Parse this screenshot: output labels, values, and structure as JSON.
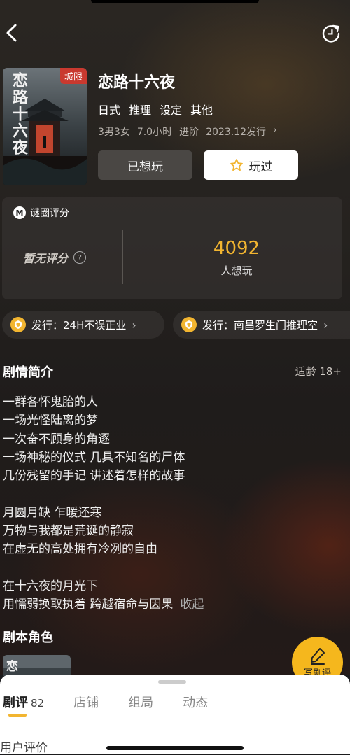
{
  "header": {
    "back_icon": "chevron-left-icon",
    "refresh_icon": "refresh-icon"
  },
  "game": {
    "cover_title_chars": "恋路十六夜",
    "cover_tag": "城限",
    "title": "恋路十六夜",
    "tags": [
      "日式",
      "推理",
      "设定",
      "其他"
    ],
    "meta": [
      "3男3女",
      "7.0小时",
      "进阶",
      "2023.12发行"
    ]
  },
  "actions": {
    "wanted_label": "已想玩",
    "played_label": "玩过"
  },
  "rating": {
    "logo_text": "M",
    "header_label": "谜圈评分",
    "no_rating_label": "暂无评分",
    "help_glyph": "?",
    "want_count": "4092",
    "want_label": "人想玩"
  },
  "publishers": [
    {
      "label": "发行：24H不误正业"
    },
    {
      "label": "发行：南昌罗生门推理室"
    }
  ],
  "synopsis": {
    "title": "剧情简介",
    "age_label": "适龄 18+",
    "lines": [
      "一群各怀鬼胎的人",
      "一场光怪陆离的梦",
      "一次奋不顾身的角逐",
      "一场神秘的仪式  几具不知名的尸体",
      "几份残留的手记  讲述着怎样的故事",
      "",
      "月圆月缺 乍暖还寒",
      "万物与我都是荒诞的静寂",
      "在虚无的高处拥有冷冽的自由",
      "",
      "在十六夜的月光下",
      "用懦弱换取执着  跨越宿命与因果"
    ],
    "collapse_label": "收起"
  },
  "roles": {
    "title": "剧本角色"
  },
  "fab": {
    "label": "写剧评",
    "icon": "pen-icon"
  },
  "tabs": [
    {
      "label": "剧评",
      "count": "82"
    },
    {
      "label": "店铺"
    },
    {
      "label": "组局"
    },
    {
      "label": "动态"
    }
  ],
  "reviews": {
    "title": "用户评价"
  },
  "colors": {
    "accent": "#f2b530",
    "fab": "#f5b71d",
    "cover_tag": "#c9392f"
  }
}
